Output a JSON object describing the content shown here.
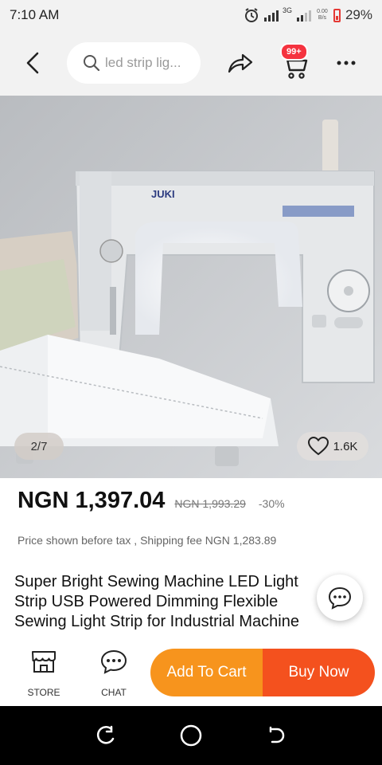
{
  "status_bar": {
    "time": "7:10 AM",
    "network": "3G",
    "speed_value": "0.00",
    "speed_unit": "B/s",
    "battery": "29%",
    "icons": [
      "alarm-icon",
      "signal-icon",
      "signal-icon",
      "battery-icon"
    ]
  },
  "header": {
    "search_text": "led strip lig...",
    "cart_badge": "99+",
    "icons": [
      "back-arrow-icon",
      "search-icon",
      "share-icon",
      "cart-icon",
      "more-icon"
    ]
  },
  "gallery": {
    "counter": "2/7",
    "likes": "1.6K"
  },
  "product": {
    "price": "NGN 1,397.04",
    "original_price": "NGN 1,993.29",
    "discount": "-30%",
    "tax_note": "Price shown before tax , Shipping fee NGN 1,283.89",
    "title": "Super Bright Sewing Machine LED Light Strip USB Powered Dimming Flexible Sewing Light Strip for Industrial Machine Working Light"
  },
  "actions": {
    "store_label": "STORE",
    "chat_label": "CHAT",
    "add_to_cart": "Add To Cart",
    "buy_now": "Buy Now"
  },
  "colors": {
    "add_to_cart": "#f7941d",
    "buy_now": "#f4511e",
    "badge": "#f5333f"
  }
}
